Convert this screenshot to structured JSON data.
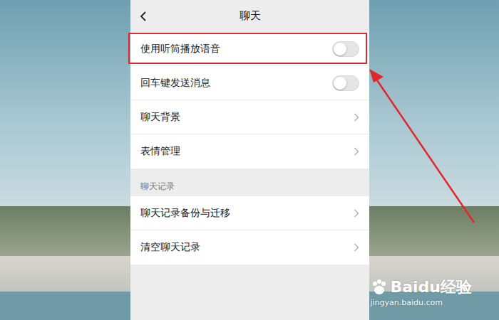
{
  "header": {
    "title": "聊天"
  },
  "general_items": [
    {
      "label": "使用听筒播放语音",
      "kind": "toggle",
      "on": false,
      "highlighted": true
    },
    {
      "label": "回车键发送消息",
      "kind": "toggle",
      "on": false,
      "highlighted": false
    },
    {
      "label": "聊天背景",
      "kind": "link",
      "on": false,
      "highlighted": false
    },
    {
      "label": "表情管理",
      "kind": "link",
      "on": false,
      "highlighted": false
    }
  ],
  "chat_history": {
    "label": "聊天记录",
    "items": [
      {
        "label": "聊天记录备份与迁移",
        "kind": "link",
        "on": false,
        "highlighted": false
      },
      {
        "label": "清空聊天记录",
        "kind": "link",
        "on": false,
        "highlighted": false
      }
    ]
  },
  "watermark": {
    "brand": "Baidu经验",
    "url": "jingyan.baidu.com"
  }
}
